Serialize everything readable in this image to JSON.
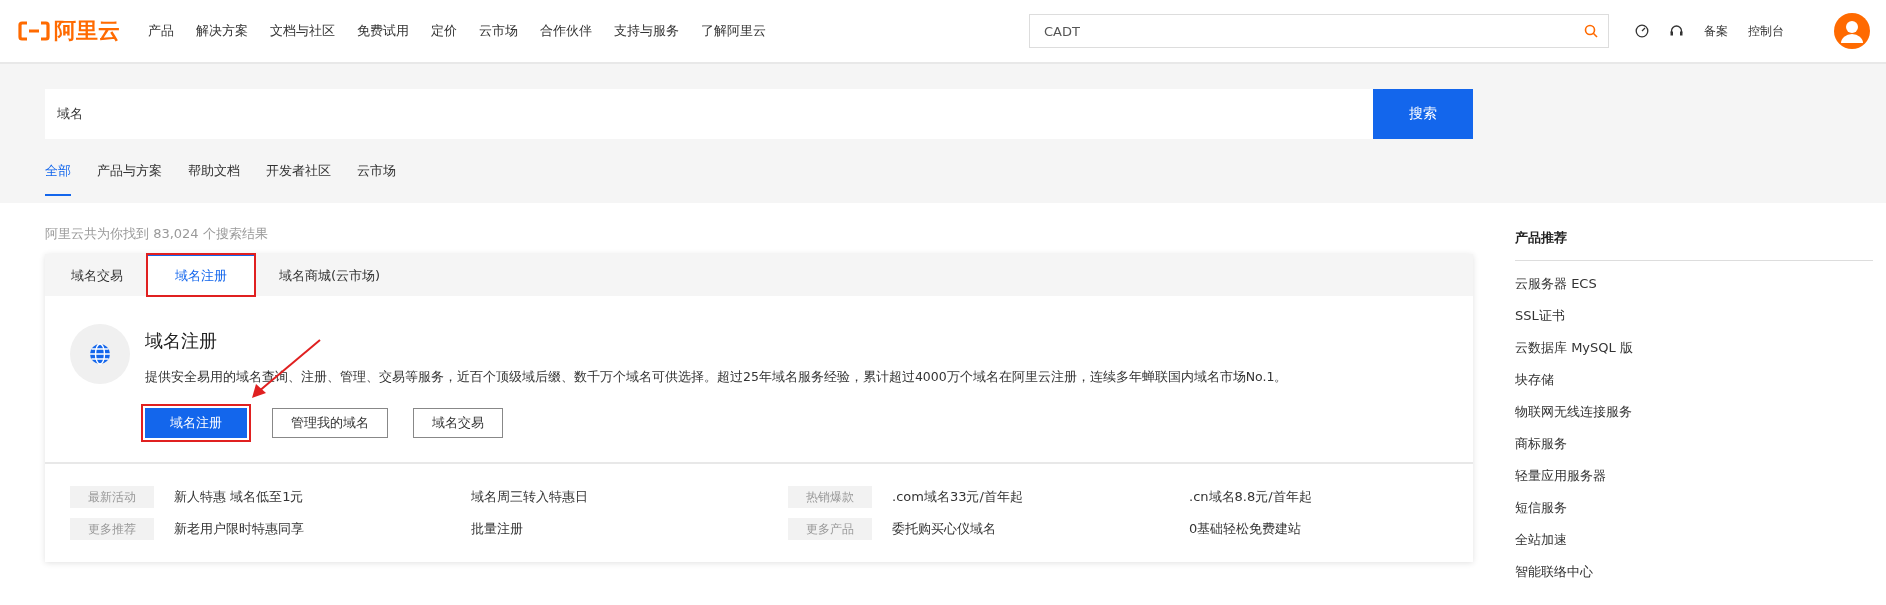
{
  "header": {
    "logo": "阿里云",
    "nav": [
      "产品",
      "解决方案",
      "文档与社区",
      "免费试用",
      "定价",
      "云市场",
      "合作伙伴",
      "支持与服务",
      "了解阿里云"
    ],
    "search": {
      "value": "CADT"
    },
    "links": [
      "备案",
      "控制台"
    ]
  },
  "search": {
    "value": "域名",
    "button": "搜索"
  },
  "tabs": [
    {
      "label": "全部",
      "selected": true
    },
    {
      "label": "产品与方案",
      "selected": false
    },
    {
      "label": "帮助文档",
      "selected": false
    },
    {
      "label": "开发者社区",
      "selected": false
    },
    {
      "label": "云市场",
      "selected": false
    }
  ],
  "result_count": "阿里云共为你找到 83,024 个搜索结果",
  "card": {
    "tabs": [
      {
        "label": "域名交易",
        "selected": false,
        "highlighted": false
      },
      {
        "label": "域名注册",
        "selected": true,
        "highlighted": true
      },
      {
        "label": "域名商城(云市场)",
        "selected": false,
        "highlighted": false
      }
    ],
    "title": "域名注册",
    "description": "提供安全易用的域名查询、注册、管理、交易等服务，近百个顶级域后缀、数千万个域名可供选择。超过25年域名服务经验，累计超过4000万个域名在阿里云注册，连续多年蝉联国内域名市场No.1。",
    "buttons": [
      {
        "label": "域名注册",
        "kind": "primary",
        "highlighted": true
      },
      {
        "label": "管理我的域名",
        "kind": "default",
        "highlighted": false
      },
      {
        "label": "域名交易",
        "kind": "default",
        "highlighted": false
      }
    ],
    "promo_groups": [
      {
        "rows": [
          {
            "tag": "最新活动",
            "links": [
              "新人特惠 域名低至1元",
              "域名周三转入特惠日"
            ]
          },
          {
            "tag": "更多推荐",
            "links": [
              "新老用户限时特惠同享",
              "批量注册"
            ]
          }
        ]
      },
      {
        "rows": [
          {
            "tag": "热销爆款",
            "links": [
              ".com域名33元/首年起",
              ".cn域名8.8元/首年起"
            ]
          },
          {
            "tag": "更多产品",
            "links": [
              "委托购买心仪域名",
              "0基础轻松免费建站"
            ]
          }
        ]
      }
    ]
  },
  "sidebar": {
    "title": "产品推荐",
    "items": [
      "云服务器 ECS",
      "SSL证书",
      "云数据库 MySQL 版",
      "块存储",
      "物联网无线连接服务",
      "商标服务",
      "轻量应用服务器",
      "短信服务",
      "全站加速",
      "智能联络中心"
    ]
  }
}
